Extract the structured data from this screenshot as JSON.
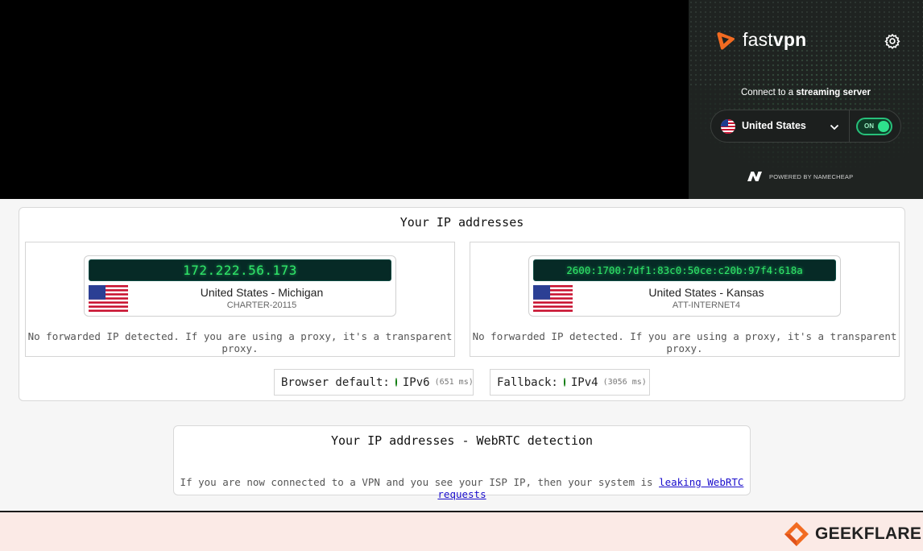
{
  "vpn": {
    "brand_light": "fast",
    "brand_bold": "vpn",
    "caption_prefix": "Connect to a ",
    "caption_bold": "streaming server",
    "country": "United States",
    "toggle_label": "ON",
    "toggle_state": "on",
    "powered_by": "POWERED BY NAMECHEAP",
    "colors": {
      "accent": "#f26b21",
      "toggle": "#2ee08c",
      "panel_bg": "#1f2321"
    }
  },
  "ip_card": {
    "title": "Your IP addresses",
    "panels": [
      {
        "ip": "172.222.56.173",
        "location": "United States - Michigan",
        "isp": "CHARTER-20115",
        "note": "No forwarded IP detected. If you are using a proxy, it's a transparent proxy."
      },
      {
        "ip": "2600:1700:7df1:83c0:50ce:c20b:97f4:618a",
        "location": "United States - Kansas",
        "isp": "ATT-INTERNET4",
        "note": "No forwarded IP detected. If you are using a proxy, it's a transparent proxy."
      }
    ],
    "browser_default_label": "Browser default:",
    "browser_default_proto": "IPv6",
    "browser_default_ms": "(651 ms)",
    "fallback_label": "Fallback:",
    "fallback_proto": "IPv4",
    "fallback_ms": "(3056 ms)"
  },
  "webrtc": {
    "title": "Your IP addresses - WebRTC detection",
    "note_prefix": "If you are now connected to a VPN and you see your ISP IP, then your system is ",
    "link_text": "leaking WebRTC requests"
  },
  "watermark": {
    "text": "GEEKFLARE",
    "color": "#f26b21"
  }
}
